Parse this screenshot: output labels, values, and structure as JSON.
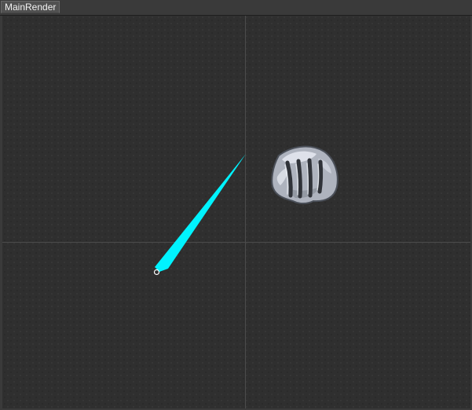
{
  "window": {
    "tab_label": "MainRender"
  },
  "icons": {
    "emitter_handle": "emitter-handle-icon",
    "rock_sprite": "rock-with-claw-marks-icon"
  },
  "colors": {
    "streak": "#00f3ff",
    "grid_line": "#4b4b4b",
    "handle_stroke": "#ffffff",
    "rock_light": "#e3e6ee",
    "rock_mid": "#a7acb7",
    "rock_dark": "#4c505a"
  }
}
